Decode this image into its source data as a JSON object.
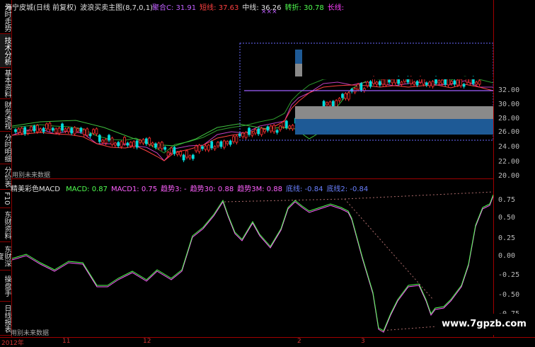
{
  "tabs": [
    "分时走势",
    "技术分析",
    "基本资料",
    "财务透视",
    "分时明细",
    "分价表",
    "F10",
    "东财资料",
    "东财深度",
    "操盘手",
    "日线报表"
  ],
  "header": {
    "title": "海宁皮城(日线 前复权)",
    "indicator": "波浪买卖主图(8,7,0,1)",
    "vals": [
      {
        "label": "聚合C:",
        "value": "31.91",
        "color": "#c060ff"
      },
      {
        "label": "短线:",
        "value": "37.63",
        "color": "#ff4040"
      },
      {
        "label": "中线:",
        "value": "36.26",
        "color": "#e0e0e0"
      },
      {
        "label": "转折:",
        "value": "30.78",
        "color": "#50ff50"
      },
      {
        "label": "长线:",
        "value": "",
        "color": "#ff40ff"
      }
    ],
    "marks": "×××"
  },
  "upper_note": "用别未来数据",
  "lower": {
    "title": "精美彩色MACD",
    "vals": [
      {
        "label": "MACD:",
        "value": "0.87",
        "color": "#50ff50"
      },
      {
        "label": "MACD1:",
        "value": "0.75",
        "color": "#ff60ff"
      },
      {
        "label": "趋势3:",
        "value": "-",
        "color": "#ff60ff"
      },
      {
        "label": "趋势30:",
        "value": "0.88",
        "color": "#ff60ff"
      },
      {
        "label": "趋势3M:",
        "value": "0.88",
        "color": "#ff60ff"
      },
      {
        "label": "底线:",
        "value": "-0.84",
        "color": "#6a80ff"
      },
      {
        "label": "底线2:",
        "value": "-0.84",
        "color": "#6a80ff"
      }
    ],
    "note": "用别未来数据"
  },
  "price_axis": [
    "32.00",
    "30.00",
    "28.00",
    "26.00",
    "24.00",
    "22.00",
    "20.00"
  ],
  "macd_axis": [
    "0.75",
    "0.50",
    "0.25",
    "0.00",
    "-0.25",
    "-0.50",
    "-0.75"
  ],
  "time_labels": [
    "2012年",
    "11",
    "12",
    "2",
    "3"
  ],
  "watermark": "www.7gpzb.com",
  "colors": {
    "frame": "#a00000",
    "up": "#ff3030",
    "down": "#00e0e0",
    "macd": "#50ff50",
    "macd1": "#ff60ff",
    "blue": "#1e5a96",
    "gray": "#8a8a8a"
  }
}
